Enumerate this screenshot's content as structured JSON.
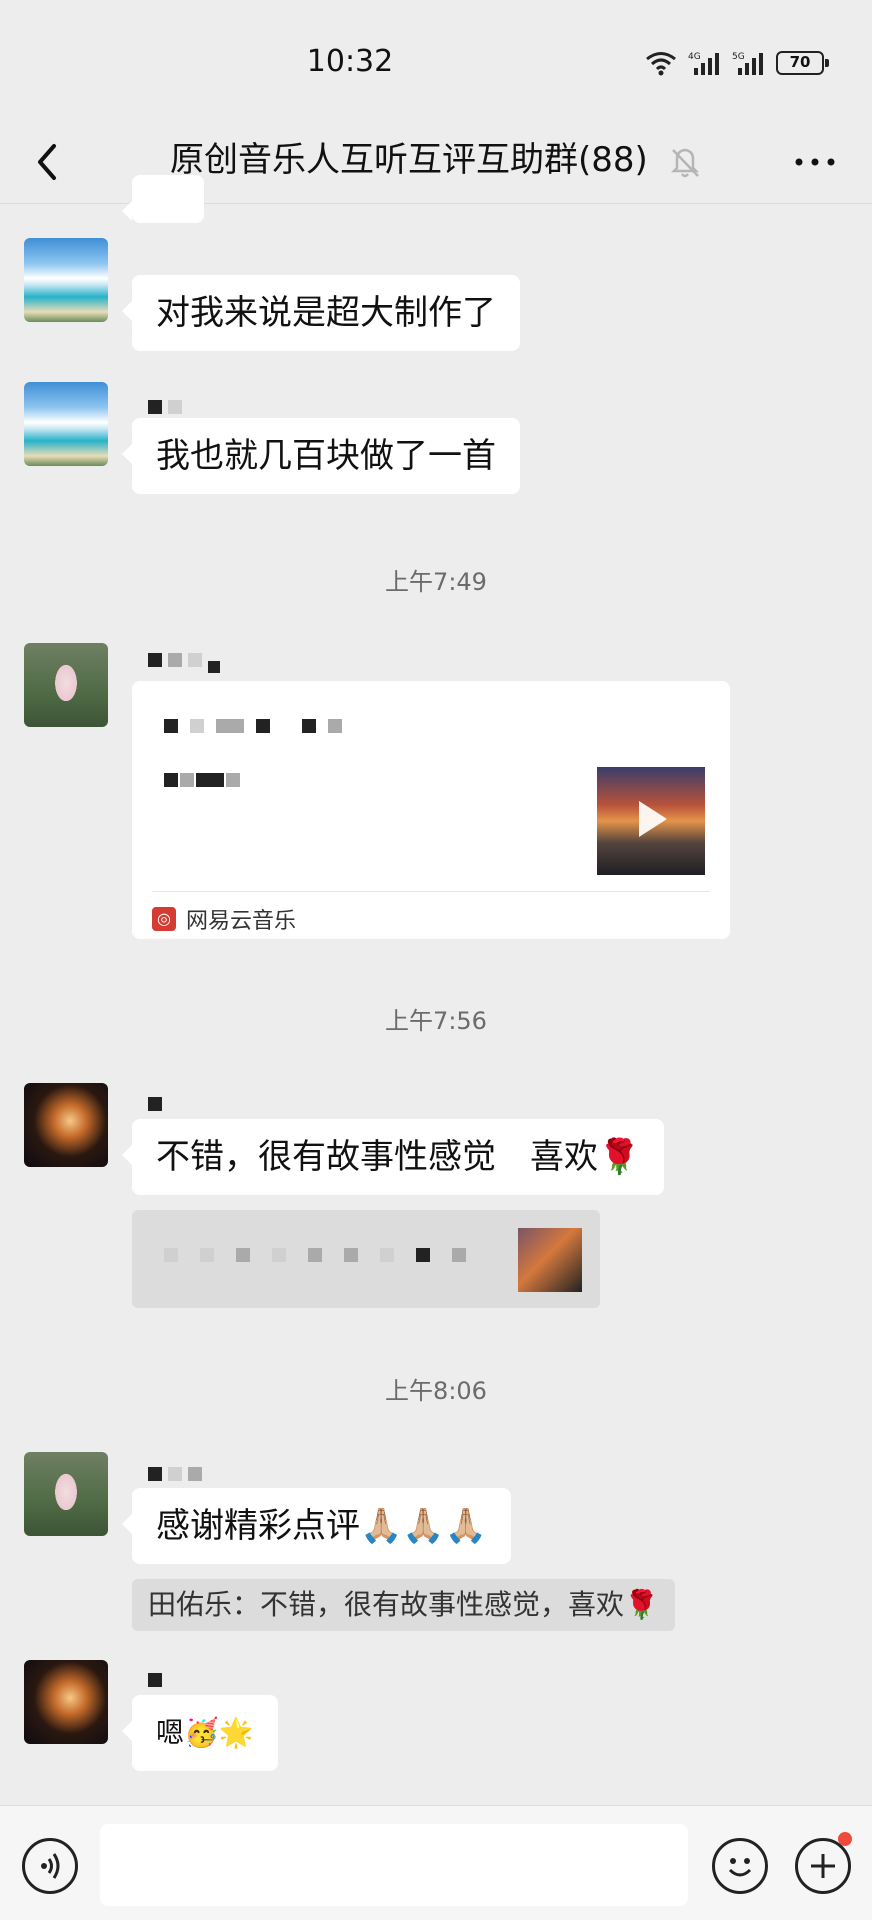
{
  "status_bar": {
    "time": "10:32",
    "network_left": "6",
    "signal_1": "4G",
    "signal_2": "5G",
    "battery": "70"
  },
  "header": {
    "title": "原创音乐人互听互评互助群(88)",
    "icons": [
      "back-icon",
      "mute-bell-icon",
      "more-icon"
    ]
  },
  "messages": [
    {
      "type": "text",
      "avatar": "sea",
      "text": "对我来说是超大制作了"
    },
    {
      "type": "text",
      "avatar": "sea",
      "text": "我也就几百块做了一首"
    },
    {
      "type": "timestamp",
      "text": "上午7:49"
    },
    {
      "type": "music_card",
      "avatar": "lotus",
      "source": "网易云音乐"
    },
    {
      "type": "timestamp",
      "text": "上午7:56"
    },
    {
      "type": "text",
      "avatar": "bird",
      "text": "不错，很有故事性感觉　喜欢🌹"
    },
    {
      "type": "timestamp",
      "text": "上午8:06"
    },
    {
      "type": "text",
      "avatar": "lotus",
      "text": "感谢精彩点评🙏🏼🙏🏼🙏🏼"
    },
    {
      "type": "quote",
      "text": "田佑乐：不错，很有故事性感觉，喜欢🌹"
    },
    {
      "type": "text",
      "avatar": "bird",
      "text": "嗯🥳🌟"
    }
  ],
  "input_bar": {
    "icons": [
      "voice-icon",
      "emoji-icon",
      "plus-icon"
    ],
    "placeholder": ""
  },
  "colors": {
    "background": "#ededed",
    "bubble": "#ffffff",
    "netease_red": "#d43c33",
    "notification_dot": "#f04a3e"
  }
}
